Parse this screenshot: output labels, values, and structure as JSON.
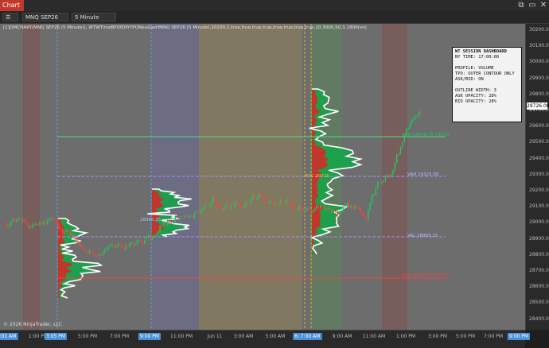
{
  "window": {
    "logo_label": "Chart",
    "controls": [
      "⧉",
      "▭",
      "✕"
    ]
  },
  "toolbar": {
    "instrument": "MNQ SEP26",
    "interval": "5 Minute"
  },
  "indicator_info": "[1]OMCHART(MNQ SEP26 (5 Minute)), WTWTimeBPOfDPrTPONeuGasHMNQ SEP26 (5 Minute),20200,2,true,true,true,true,true,true,true,true,10,3000,50,3,1800(vn)",
  "dashboard": {
    "title": "WT SESSION DASHBOARD",
    "rows": [
      "NY TIME: 17:00:00",
      "",
      "PROFILE: VOLUME",
      "TPO: OUTER CONTOUR ONLY",
      "ASK/BID: ON",
      "",
      "OUTLINE WIDTH: 3",
      "ASK OPACITY: 28%",
      "BID OPACITY: 28%"
    ]
  },
  "price_axis": {
    "ticks": [
      "30200.00",
      "30100.00",
      "30000.00",
      "29900.00",
      "29800.00",
      "29700.00",
      "29600.00",
      "29500.00",
      "29400.00",
      "29300.00",
      "29200.00",
      "29100.00",
      "29000.00",
      "28900.00",
      "28800.00",
      "28700.00",
      "28600.00",
      "28500.00",
      "28400.00"
    ],
    "current_price": "29726.00"
  },
  "time_axis": {
    "ticks": [
      "7:01 AM",
      "1:00 PM",
      "3:05 PM",
      "5:00 PM",
      "7:00 PM",
      "9:00 PM",
      "11:00 PM",
      "Jun 11",
      "3:00 AM",
      "5:00 AM",
      "6:30",
      "7:00 AM",
      "9:00 AM",
      "11:00 AM",
      "1:00 PM",
      "3:00 PM",
      "5:00 PM",
      "7:00 PM",
      "9:00 PM"
    ],
    "highlighted": [
      "7:01 AM",
      "3:05 PM",
      "9:00 PM",
      "6:30",
      "7:00 AM"
    ]
  },
  "levels": [
    {
      "label": "POH 29648.75 TX52%"
    },
    {
      "label": "VAH 29325.00"
    },
    {
      "label": "VAL 28969.25"
    },
    {
      "label": "POH 28741.75 TX52%"
    }
  ],
  "overlay_labels": [
    "POC 29715",
    "28966.25"
  ],
  "copyright": "© 2026 NinjaTrader, LLC",
  "colors": {
    "background": "#6d6d6d",
    "up_candle": "#22c55e",
    "down_candle": "#ef4444",
    "profile_bid": "#16a34a",
    "profile_ask": "#dc2626",
    "outline": "#ffffff"
  }
}
